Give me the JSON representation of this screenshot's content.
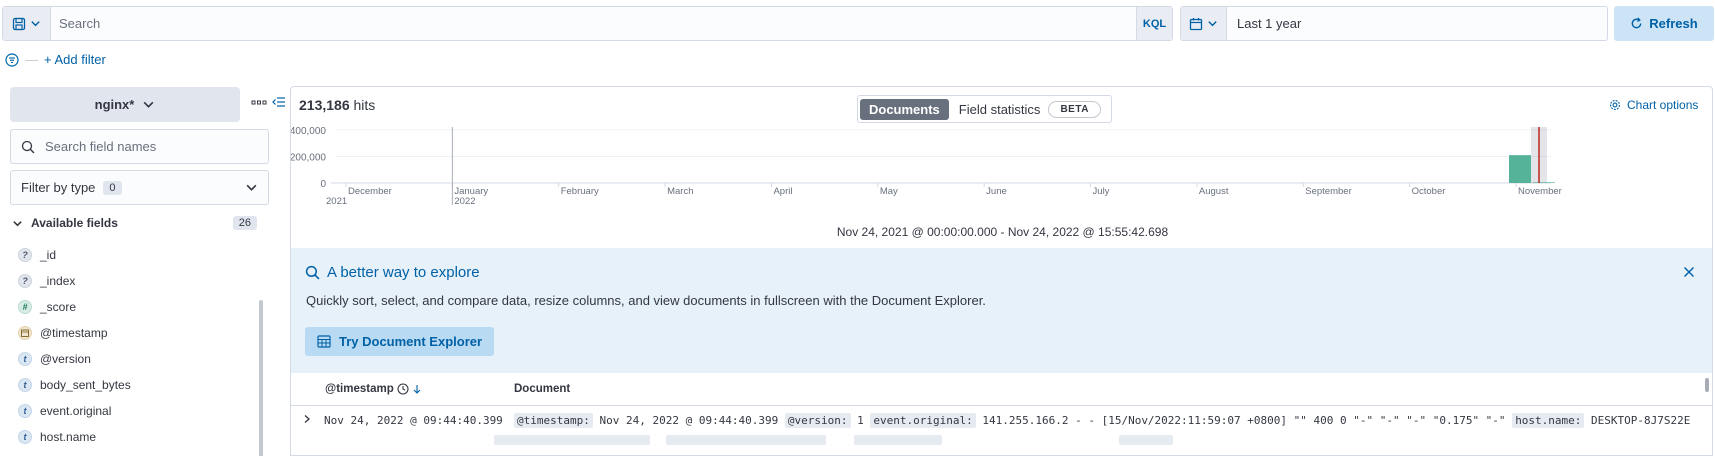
{
  "query": {
    "placeholder": "Search",
    "language": "KQL"
  },
  "time": {
    "range_label": "Last 1 year",
    "refresh_label": "Refresh"
  },
  "filters": {
    "add_label": "+ Add filter"
  },
  "sidebar": {
    "index_pattern": "nginx*",
    "field_search_placeholder": "Search field names",
    "filter_by_type_label": "Filter by type",
    "filter_by_type_count": "0",
    "available_label": "Available fields",
    "available_count": "26",
    "fields": [
      {
        "name": "_id",
        "type": "unknown"
      },
      {
        "name": "_index",
        "type": "unknown"
      },
      {
        "name": "_score",
        "type": "number"
      },
      {
        "name": "@timestamp",
        "type": "date"
      },
      {
        "name": "@version",
        "type": "string"
      },
      {
        "name": "body_sent_bytes",
        "type": "string"
      },
      {
        "name": "event.original",
        "type": "string"
      },
      {
        "name": "host.name",
        "type": "string"
      }
    ]
  },
  "main": {
    "hits_count": "213,186",
    "hits_label": "hits",
    "tab_documents": "Documents",
    "tab_field_statistics": "Field statistics",
    "beta_badge": "BETA",
    "chart_options_label": "Chart options",
    "date_range": "Nov 24, 2021 @ 00:00:00.000 - Nov 24, 2022 @ 15:55:42.698"
  },
  "chart_data": {
    "type": "bar",
    "y_ticks": [
      "400,000",
      "200,000",
      "0"
    ],
    "ylim": [
      0,
      400000
    ],
    "x_ticks": [
      {
        "label": "December",
        "sub": "2021"
      },
      {
        "label": "January",
        "sub": "2022"
      },
      {
        "label": "February",
        "sub": ""
      },
      {
        "label": "March",
        "sub": ""
      },
      {
        "label": "April",
        "sub": ""
      },
      {
        "label": "May",
        "sub": ""
      },
      {
        "label": "June",
        "sub": ""
      },
      {
        "label": "July",
        "sub": ""
      },
      {
        "label": "August",
        "sub": ""
      },
      {
        "label": "September",
        "sub": ""
      },
      {
        "label": "October",
        "sub": ""
      },
      {
        "label": "November",
        "sub": ""
      }
    ],
    "bars": [
      {
        "period": "mid-November 2022",
        "value": 210000
      },
      {
        "period": "late November 2022",
        "value": 5000
      }
    ],
    "bar_color": "#54b399",
    "now_marker_color": "#bd271e"
  },
  "callout": {
    "title": "A better way to explore",
    "description": "Quickly sort, select, and compare data, resize columns, and view documents in fullscreen with the Document Explorer.",
    "button_label": "Try Document Explorer"
  },
  "table": {
    "col_timestamp": "@timestamp",
    "col_document": "Document",
    "rows": [
      {
        "timestamp": "Nov 24, 2022 @ 09:44:40.399",
        "k1": "@timestamp:",
        "v1": " Nov 24, 2022 @ 09:44:40.399 ",
        "k2": "@version:",
        "v2": " 1 ",
        "k3": "event.original:",
        "v3": " 141.255.166.2 - - [15/Nov/2022:11:59:07 +0800] \"\" 400 0 \"-\" \"-\" \"-\" \"0.175\" \"-\" ",
        "k4": "host.name:",
        "v4": " DESKTOP-8J7S22E"
      }
    ]
  }
}
